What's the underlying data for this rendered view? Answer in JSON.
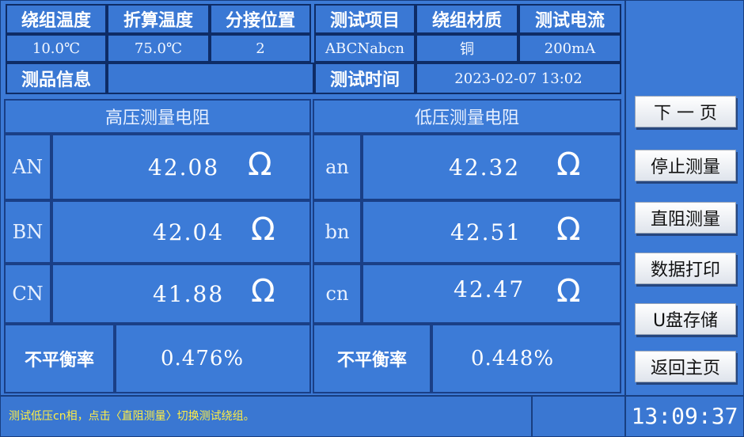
{
  "header": {
    "labels": [
      "绕组温度",
      "折算温度",
      "分接位置",
      "测试项目",
      "绕组材质",
      "测试电流"
    ],
    "values": [
      "10.0℃",
      "75.0℃",
      "2",
      "ABCNabcn",
      "铜",
      "200mA"
    ],
    "sample_info_label": "测品信息",
    "sample_info_value": "",
    "test_time_label": "测试时间",
    "test_time_value": "2023-02-07  13:02"
  },
  "hv": {
    "title": "高压测量电阻",
    "rows": [
      {
        "phase": "AN",
        "value": "42.08",
        "unit": "Ω"
      },
      {
        "phase": "BN",
        "value": "42.04",
        "unit": "Ω"
      },
      {
        "phase": "CN",
        "value": "41.88",
        "unit": "Ω"
      }
    ],
    "imbalance_label": "不平衡率",
    "imbalance_value": "0.476%"
  },
  "lv": {
    "title": "低压测量电阻",
    "rows": [
      {
        "phase": "an",
        "value": "42.32",
        "unit": "Ω"
      },
      {
        "phase": "bn",
        "value": "42.51",
        "unit": "Ω"
      },
      {
        "phase": "cn",
        "value": "42.47",
        "unit": "Ω"
      }
    ],
    "imbalance_label": "不平衡率",
    "imbalance_value": "0.448%"
  },
  "sidebar": {
    "buttons": [
      "下 一 页",
      "停止测量",
      "直阻测量",
      "数据打印",
      "U盘存储",
      "返回主页"
    ]
  },
  "footer": {
    "status": "测试低压cn相，点击〈直阻测量〉切换测试绕组。",
    "clock": "13:09:37"
  }
}
